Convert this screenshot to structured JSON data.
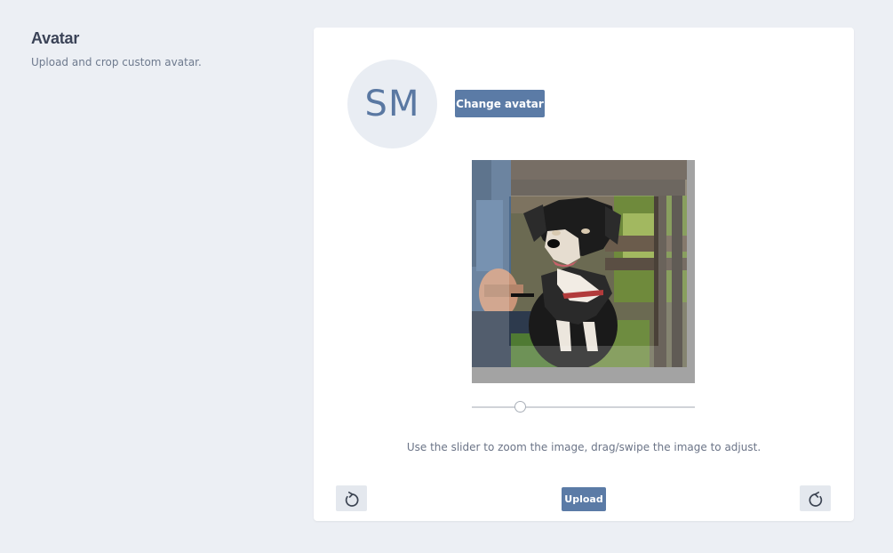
{
  "section": {
    "title": "Avatar",
    "description": "Upload and crop custom avatar."
  },
  "avatar": {
    "initials": "SM",
    "change_label": "Change avatar"
  },
  "cropper": {
    "photo_subject": "black dog sitting on a wooden bench",
    "zoom_level": 0.22
  },
  "hint": "Use the slider to zoom the image, drag/swipe the image to adjust.",
  "actions": {
    "rotate_left_icon": "rotate-left-icon",
    "upload_label": "Upload",
    "rotate_right_icon": "rotate-right-icon"
  },
  "colors": {
    "background": "#eceff4",
    "card": "#ffffff",
    "primary": "#5b7ba6",
    "avatar_bg": "#e9edf3",
    "avatar_text": "#5a78a2"
  }
}
